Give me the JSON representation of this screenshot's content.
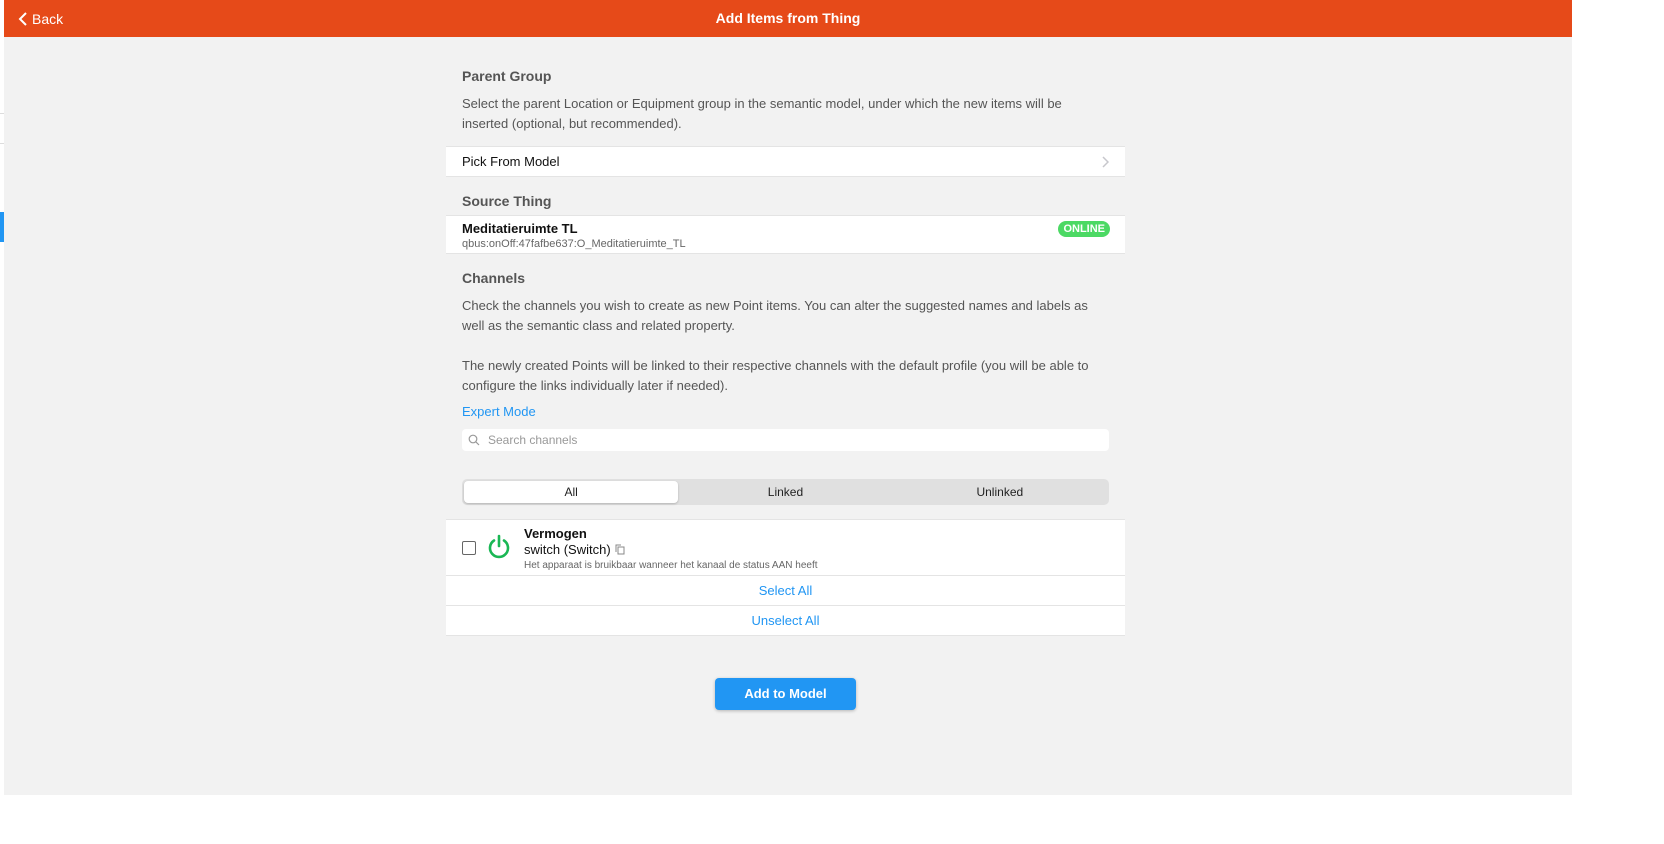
{
  "navbar": {
    "back_label": "Back",
    "title": "Add Items from Thing",
    "color": "#e64a19"
  },
  "parent_group": {
    "title": "Parent Group",
    "description": "Select the parent Location or Equipment group in the semantic model, under which the new items will be inserted (optional, but recommended).",
    "pick_label": "Pick From Model"
  },
  "source_thing": {
    "title": "Source Thing",
    "name": "Meditatieruimte TL",
    "uid": "qbus:onOff:47fafbe637:O_Meditatieruimte_TL",
    "status": "ONLINE",
    "status_color": "#4cd964"
  },
  "channels": {
    "title": "Channels",
    "description1": "Check the channels you wish to create as new Point items. You can alter the suggested names and labels as well as the semantic class and related property.",
    "description2": "The newly created Points will be linked to their respective channels with the default profile (you will be able to configure the links individually later if needed).",
    "expert_mode_label": "Expert Mode",
    "search_placeholder": "Search channels",
    "filters": [
      "All",
      "Linked",
      "Unlinked"
    ],
    "active_filter": "All",
    "items": [
      {
        "name": "Vermogen",
        "type": "switch (Switch)",
        "description": "Het apparaat is bruikbaar wanneer het kanaal de status AAN heeft",
        "icon": "power-icon",
        "checked": false
      }
    ],
    "select_all_label": "Select All",
    "unselect_all_label": "Unselect All"
  },
  "add_button_label": "Add to Model",
  "accent_color": "#2196f3"
}
